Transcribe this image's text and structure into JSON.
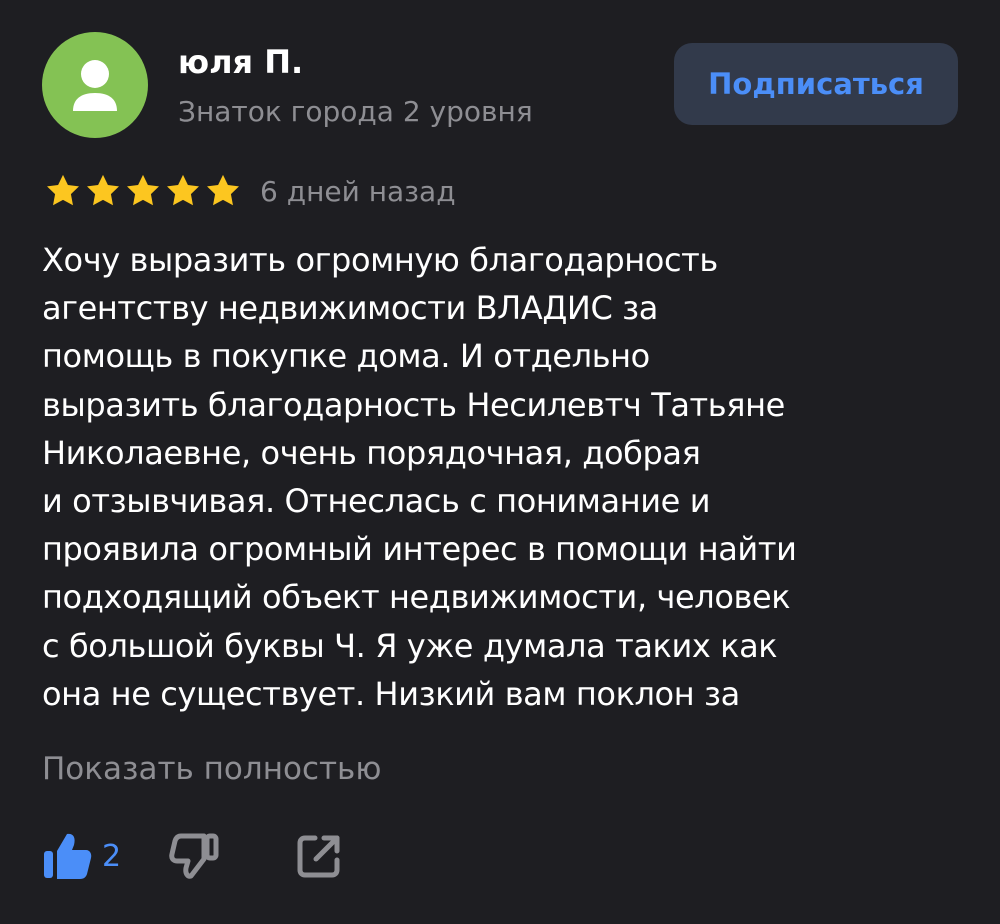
{
  "author": {
    "name": "юля П.",
    "level": "Знаток города 2 уровня",
    "avatar_color": "#84c254",
    "avatar_icon": "user-silhouette-icon"
  },
  "subscribe_label": "Подписаться",
  "rating": {
    "stars": 5,
    "max": 5,
    "star_color": "#fcc620",
    "date": "6 дней назад"
  },
  "review_lines": [
    "Хочу выразить огромную благодарность",
    "агентству недвижимости ВЛАДИС за",
    "помощь в покупке дома. И отдельно",
    "выразить благодарность Несилевтч Татьяне",
    "Николаевне, очень порядочная, добрая",
    "и отзывчивая. Отнеслась с понимание и",
    "проявила огромный интерес в помощи найти",
    "подходящий объект недвижимости, человек",
    "с большой буквы Ч. Я уже думала таких как",
    "она не существует. Низкий вам поклон за"
  ],
  "show_more_label": "Показать полностью",
  "actions": {
    "like_icon": "thumbs-up-icon",
    "like_count": "2",
    "dislike_icon": "thumbs-down-icon",
    "share_icon": "share-icon",
    "accent_color": "#4b8ef8",
    "muted_color": "#8e8e93"
  }
}
